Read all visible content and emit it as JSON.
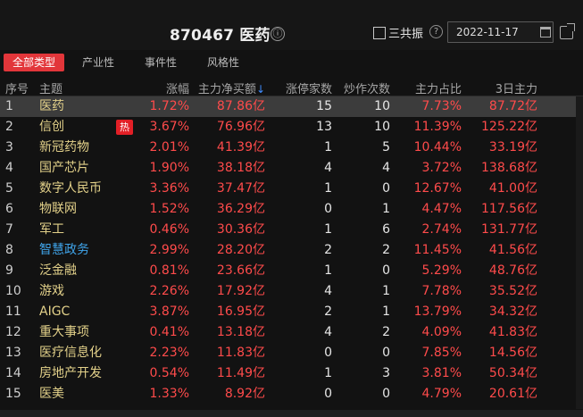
{
  "header": {
    "title": "870467 医药",
    "info_icon": "ⓘ",
    "gongzhen_label": "三共振",
    "help_icon": "?",
    "date": "2022-11-17"
  },
  "tabs": [
    {
      "label": "全部类型",
      "active": true
    },
    {
      "label": "产业性",
      "active": false
    },
    {
      "label": "事件性",
      "active": false
    },
    {
      "label": "风格性",
      "active": false
    }
  ],
  "columns": {
    "idx": "序号",
    "theme": "主题",
    "change": "涨幅",
    "netbuy": "主力净买额",
    "sort_icon": "↓",
    "limitup": "涨停家数",
    "hype": "炒作次数",
    "share": "主力占比",
    "main3d": "3日主力"
  },
  "hot_badge": "热",
  "rows": [
    {
      "idx": "1",
      "name": "医药",
      "change": "1.72%",
      "netbuy": "87.86亿",
      "limitup": "15",
      "hype": "10",
      "share": "7.73%",
      "main3d": "87.72亿",
      "selected": true
    },
    {
      "idx": "2",
      "name": "信创",
      "change": "3.67%",
      "netbuy": "76.96亿",
      "limitup": "13",
      "hype": "10",
      "share": "11.39%",
      "main3d": "125.22亿",
      "hot": true
    },
    {
      "idx": "3",
      "name": "新冠药物",
      "change": "2.01%",
      "netbuy": "41.39亿",
      "limitup": "1",
      "hype": "5",
      "share": "10.44%",
      "main3d": "33.19亿"
    },
    {
      "idx": "4",
      "name": "国产芯片",
      "change": "1.90%",
      "netbuy": "38.18亿",
      "limitup": "4",
      "hype": "4",
      "share": "3.72%",
      "main3d": "138.68亿"
    },
    {
      "idx": "5",
      "name": "数字人民币",
      "change": "3.36%",
      "netbuy": "37.47亿",
      "limitup": "1",
      "hype": "0",
      "share": "12.67%",
      "main3d": "41.00亿"
    },
    {
      "idx": "6",
      "name": "物联网",
      "change": "1.52%",
      "netbuy": "36.29亿",
      "limitup": "0",
      "hype": "1",
      "share": "4.47%",
      "main3d": "117.56亿"
    },
    {
      "idx": "7",
      "name": "军工",
      "change": "0.46%",
      "netbuy": "30.36亿",
      "limitup": "1",
      "hype": "6",
      "share": "2.74%",
      "main3d": "131.77亿"
    },
    {
      "idx": "8",
      "name": "智慧政务",
      "change": "2.99%",
      "netbuy": "28.20亿",
      "limitup": "2",
      "hype": "2",
      "share": "11.45%",
      "main3d": "41.56亿",
      "link": true
    },
    {
      "idx": "9",
      "name": "泛金融",
      "change": "0.81%",
      "netbuy": "23.66亿",
      "limitup": "1",
      "hype": "0",
      "share": "5.29%",
      "main3d": "48.76亿"
    },
    {
      "idx": "10",
      "name": "游戏",
      "change": "2.26%",
      "netbuy": "17.92亿",
      "limitup": "4",
      "hype": "1",
      "share": "7.78%",
      "main3d": "35.52亿"
    },
    {
      "idx": "11",
      "name": "AIGC",
      "change": "3.87%",
      "netbuy": "16.95亿",
      "limitup": "2",
      "hype": "1",
      "share": "13.79%",
      "main3d": "34.32亿"
    },
    {
      "idx": "12",
      "name": "重大事项",
      "change": "0.41%",
      "netbuy": "13.18亿",
      "limitup": "4",
      "hype": "2",
      "share": "4.09%",
      "main3d": "41.83亿"
    },
    {
      "idx": "13",
      "name": "医疗信息化",
      "change": "2.23%",
      "netbuy": "11.83亿",
      "limitup": "0",
      "hype": "0",
      "share": "7.85%",
      "main3d": "14.56亿"
    },
    {
      "idx": "14",
      "name": "房地产开发",
      "change": "0.54%",
      "netbuy": "11.49亿",
      "limitup": "1",
      "hype": "3",
      "share": "3.81%",
      "main3d": "50.34亿"
    },
    {
      "idx": "15",
      "name": "医美",
      "change": "1.33%",
      "netbuy": "8.92亿",
      "limitup": "0",
      "hype": "0",
      "share": "4.79%",
      "main3d": "20.61亿"
    }
  ]
}
